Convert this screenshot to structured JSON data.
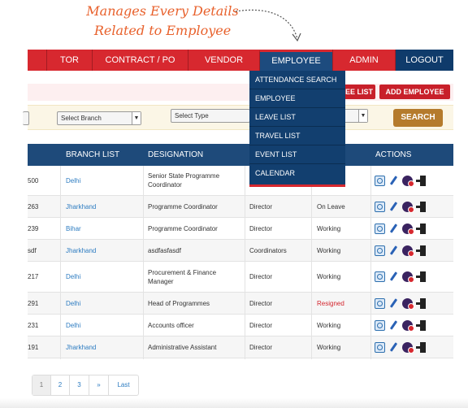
{
  "annotation": {
    "line1": "Manages Every Details",
    "line2": "Related to Employee",
    "color": "#e8612c"
  },
  "nav": [
    "TOR",
    "CONTRACT / PO",
    "VENDOR",
    "EMPLOYEE",
    "ADMIN",
    "LOGOUT"
  ],
  "toolbar": {
    "add_leave_fragment": "EE LIST",
    "add_employee": "ADD EMPLOYEE"
  },
  "filters": {
    "select_branch": "Select Branch",
    "select_type": "Select Type",
    "search": "SEARCH"
  },
  "dropdown": [
    "ATTENDANCE SEARCH",
    "EMPLOYEE",
    "LEAVE LIST",
    "TRAVEL LIST",
    "EVENT LIST",
    "CALENDAR"
  ],
  "table": {
    "headers": [
      "BRANCH LIST",
      "DESIGNATION",
      "ACTIONS"
    ],
    "rows": [
      {
        "id": "500",
        "branch": "Delhi",
        "designation": "Senior State Programme Coordinator",
        "level": "",
        "status": ""
      },
      {
        "id": "263",
        "branch": "Jharkhand",
        "designation": "Programme Coordinator",
        "level": "Director",
        "status": "On Leave"
      },
      {
        "id": "239",
        "branch": "Bihar",
        "designation": "Programme Coordinator",
        "level": "Director",
        "status": "Working"
      },
      {
        "id": "sdf",
        "branch": "Jharkhand",
        "designation": "asdfasfasdf",
        "level": "Coordinators",
        "status": "Working"
      },
      {
        "id": "217",
        "branch": "Delhi",
        "designation": "Procurement & Finance Manager",
        "level": "Director",
        "status": "Working"
      },
      {
        "id": "291",
        "branch": "Delhi",
        "designation": "Head of Programmes",
        "level": "Director",
        "status": "Resigned"
      },
      {
        "id": "231",
        "branch": "Delhi",
        "designation": "Accounts officer",
        "level": "Director",
        "status": "Working"
      },
      {
        "id": "191",
        "branch": "Jharkhand",
        "designation": "Administrative Assistant",
        "level": "Director",
        "status": "Working"
      }
    ]
  },
  "pager": [
    "1",
    "2",
    "3",
    "»",
    "Last"
  ],
  "colors": {
    "nav_red": "#d7282f",
    "nav_blue": "#0f3b6b",
    "table_header": "#1e4a7a",
    "link": "#2d7cc1",
    "resigned": "#d3262e",
    "search_btn": "#b57b2c"
  }
}
